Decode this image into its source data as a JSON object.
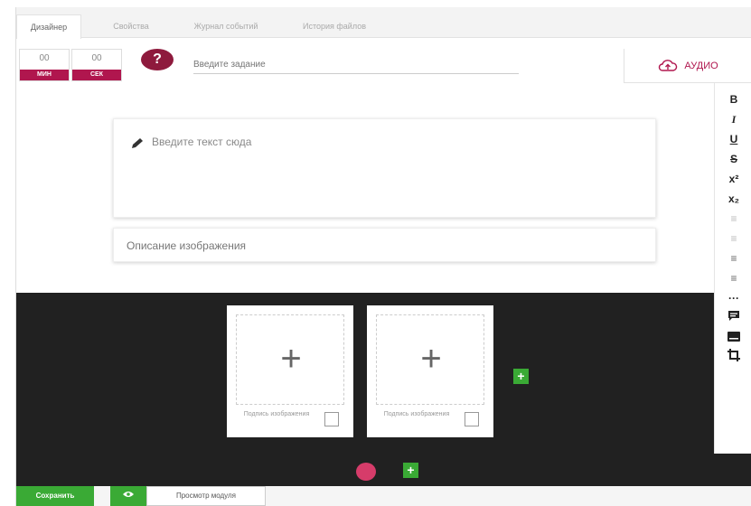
{
  "tabs": [
    {
      "label": "Дизайнер",
      "active": true
    },
    {
      "label": "Свойства",
      "active": false
    },
    {
      "label": "Журнал событий",
      "active": false
    },
    {
      "label": "История файлов",
      "active": false
    }
  ],
  "timer": {
    "minutes": "00",
    "minutes_unit": "МИН",
    "seconds": "00",
    "seconds_unit": "СЕК"
  },
  "task": {
    "help_icon": "question-icon",
    "placeholder": "Введите задание"
  },
  "audio": {
    "label": "АУДИО",
    "icon": "cloud-upload-icon"
  },
  "editor": {
    "text_placeholder": "Введите текст сюда",
    "description_placeholder": "Описание изображения"
  },
  "toolbar": {
    "bold": "B",
    "italic": "I",
    "underline": "U",
    "strike": "S",
    "superscript": "x²",
    "subscript": "x₂",
    "align_left": "≡",
    "align_center": "≡",
    "list_unordered": "≡",
    "list_ordered": "≡",
    "more": "···"
  },
  "images": [
    {
      "plus": "+",
      "caption": "Подпись изображения"
    },
    {
      "plus": "+",
      "caption": "Подпись изображения"
    }
  ],
  "add_symbol": "+",
  "footer": {
    "save_label": "Сохранить",
    "preview_label": "Просмотр модуля"
  },
  "colors": {
    "brand": "#b0164e",
    "accent_green": "#3aaa35",
    "dark_panel": "#212121",
    "pink_dot": "#d63c6a"
  }
}
